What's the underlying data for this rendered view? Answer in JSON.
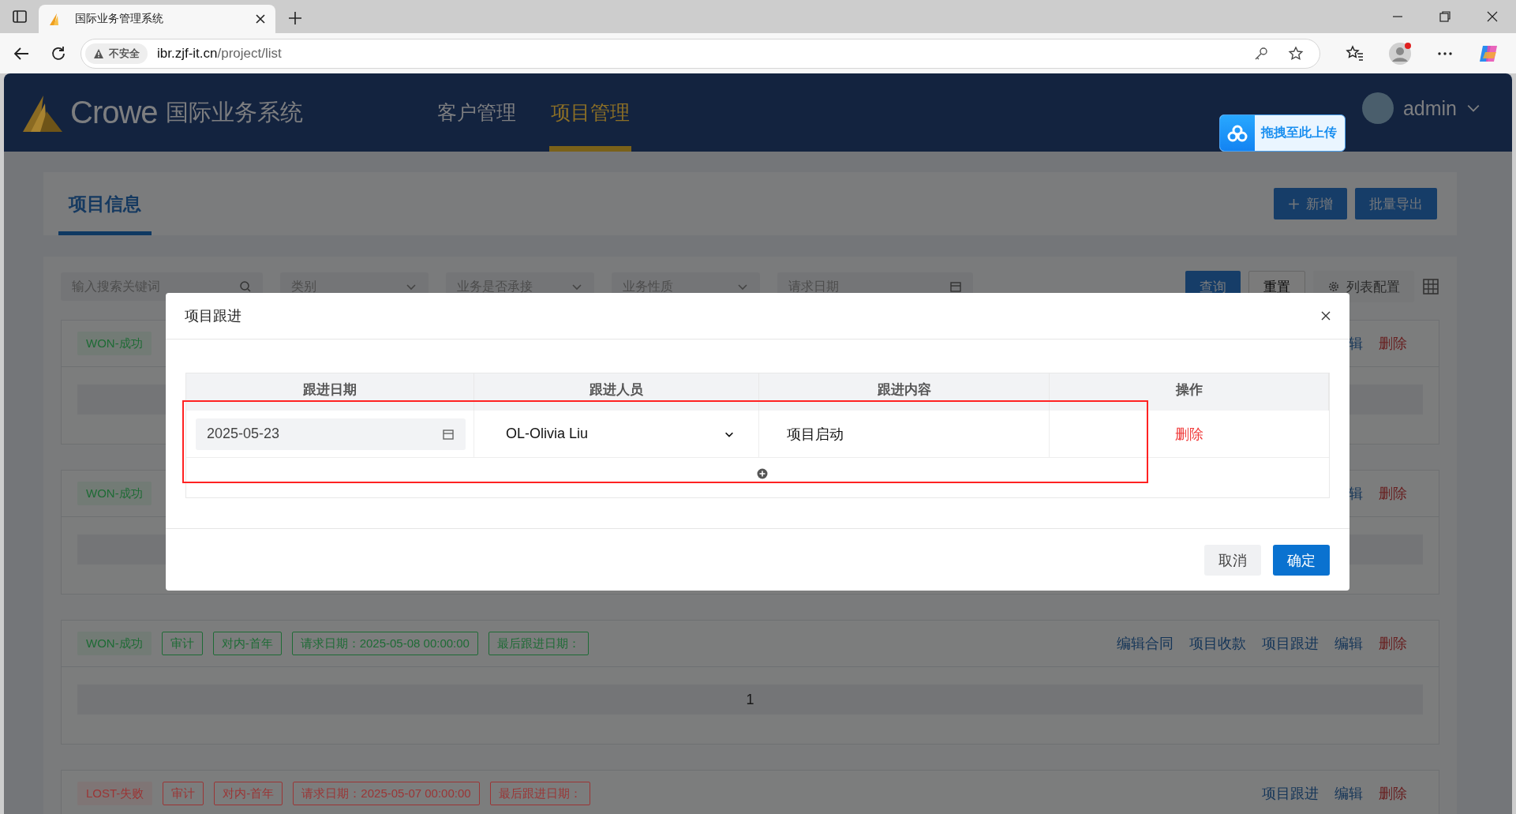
{
  "browser": {
    "tab_title": "国际业务管理系统",
    "security_label": "不安全",
    "url_host": "ibr.zjf-it.cn",
    "url_path": "/project/list"
  },
  "header": {
    "brand": "Crowe",
    "system_name": "国际业务系统",
    "nav": [
      {
        "label": "客户管理",
        "selected": false
      },
      {
        "label": "项目管理",
        "selected": true
      }
    ],
    "upload_button": "拖拽至此上传",
    "user": "admin"
  },
  "page": {
    "tabs": [
      {
        "label": "项目信息",
        "selected": true
      }
    ],
    "actions": [
      {
        "label": "新增",
        "kind": "add"
      },
      {
        "label": "批量导出",
        "kind": "export"
      }
    ]
  },
  "filters": [
    {
      "placeholder": "输入搜索关键词",
      "kind": "search"
    },
    {
      "placeholder": "类别",
      "kind": "select"
    },
    {
      "placeholder": "业务是否承接",
      "kind": "select"
    },
    {
      "placeholder": "业务性质",
      "kind": "select"
    },
    {
      "placeholder": "请求日期",
      "kind": "date"
    }
  ],
  "filter_buttons": [
    {
      "label": "查询",
      "kind": "primary"
    },
    {
      "label": "重置",
      "kind": "default"
    },
    {
      "label": "列表配置",
      "kind": "config"
    }
  ],
  "projects": [
    {
      "color": "#1e6b35",
      "tags": [
        {
          "label": "WON-成功",
          "kind": "status"
        }
      ],
      "actions": [
        {
          "label": "辑",
          "kind": "link"
        },
        {
          "label": "删除",
          "kind": "danger"
        }
      ]
    },
    {
      "color": "#1e6b35",
      "tags": [
        {
          "label": "WON-成功",
          "kind": "status"
        }
      ],
      "actions": [
        {
          "label": "辑",
          "kind": "link"
        },
        {
          "label": "删除",
          "kind": "danger"
        }
      ]
    },
    {
      "color": "#1e6b35",
      "tags": [
        {
          "label": "WON-成功",
          "kind": "status"
        },
        {
          "label": "审计",
          "kind": "outline"
        },
        {
          "label": "对内-首年",
          "kind": "outline"
        },
        {
          "label": "请求日期：2025-05-08 00:00:00",
          "kind": "outline"
        },
        {
          "label": "最后跟进日期：",
          "kind": "outline"
        }
      ],
      "actions": [
        {
          "label": "编辑合同",
          "kind": "link"
        },
        {
          "label": "项目收款",
          "kind": "link"
        },
        {
          "label": "项目跟进",
          "kind": "link"
        },
        {
          "label": "编辑",
          "kind": "link"
        },
        {
          "label": "删除",
          "kind": "danger"
        }
      ],
      "body": "1"
    },
    {
      "color": "#9b3535",
      "tags": [
        {
          "label": "LOST-失败",
          "kind": "status"
        },
        {
          "label": "审计",
          "kind": "outline"
        },
        {
          "label": "对内-首年",
          "kind": "outline"
        },
        {
          "label": "请求日期：2025-05-07 00:00:00",
          "kind": "outline"
        },
        {
          "label": "最后跟进日期：",
          "kind": "outline"
        }
      ],
      "actions": [
        {
          "label": "项目跟进",
          "kind": "link"
        },
        {
          "label": "编辑",
          "kind": "link"
        },
        {
          "label": "删除",
          "kind": "danger"
        }
      ]
    }
  ],
  "modal": {
    "title": "项目跟进",
    "columns": [
      "跟进日期",
      "跟进人员",
      "跟进内容",
      "操作"
    ],
    "rows": [
      {
        "date": "2025-05-23",
        "person": "OL-Olivia Liu",
        "content": "项目启动",
        "action": "删除"
      }
    ],
    "buttons": [
      {
        "label": "取消",
        "kind": "default"
      },
      {
        "label": "确定",
        "kind": "primary"
      }
    ]
  }
}
